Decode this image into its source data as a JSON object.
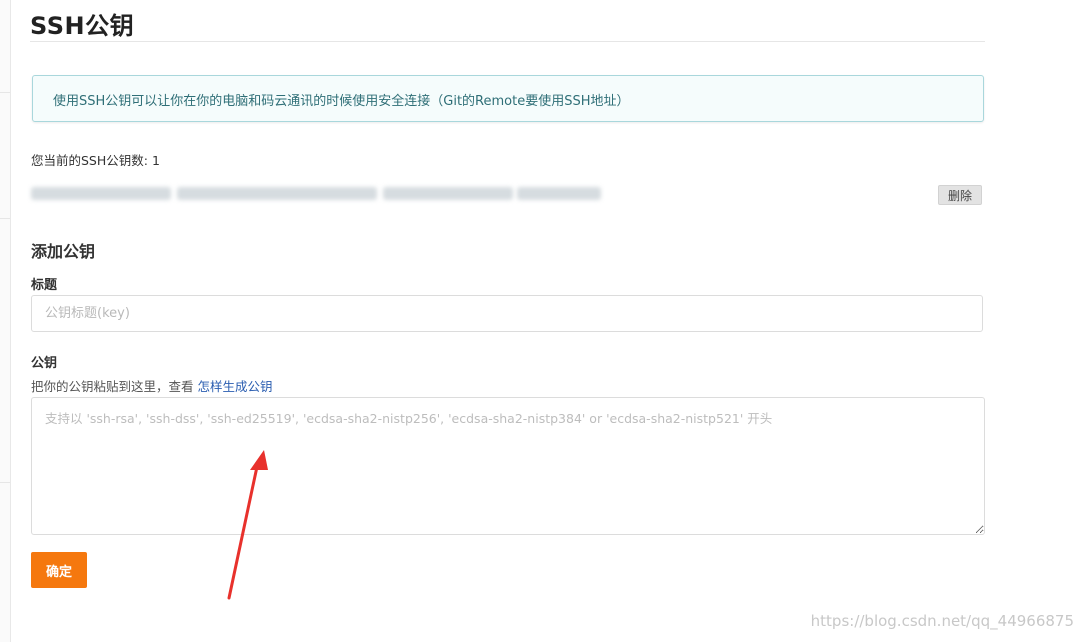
{
  "page": {
    "title": "SSH公钥"
  },
  "info": {
    "text": "使用SSH公钥可以让你在你的电脑和码云通讯的时候使用安全连接（Git的Remote要使用SSH地址）"
  },
  "keys": {
    "count_text": "您当前的SSH公钥数: 1",
    "delete_label": "删除"
  },
  "add_key": {
    "section_title": "添加公钥",
    "title_label": "标题",
    "title_placeholder": "公钥标题(key)",
    "key_label": "公钥",
    "help_text": "把你的公钥粘贴到这里，查看 ",
    "help_link": "怎样生成公钥",
    "key_placeholder": "支持以 'ssh-rsa', 'ssh-dss', 'ssh-ed25519', 'ecdsa-sha2-nistp256', 'ecdsa-sha2-nistp384' or 'ecdsa-sha2-nistp521' 开头",
    "confirm_label": "确定"
  },
  "watermark": {
    "text": "https://blog.csdn.net/qq_44966875"
  },
  "colors": {
    "accent_orange": "#f5780e",
    "info_bg": "#f5fcfc",
    "info_border": "#a9d7dc",
    "link_blue": "#2a5db0",
    "arrow_red": "#e8312c"
  }
}
